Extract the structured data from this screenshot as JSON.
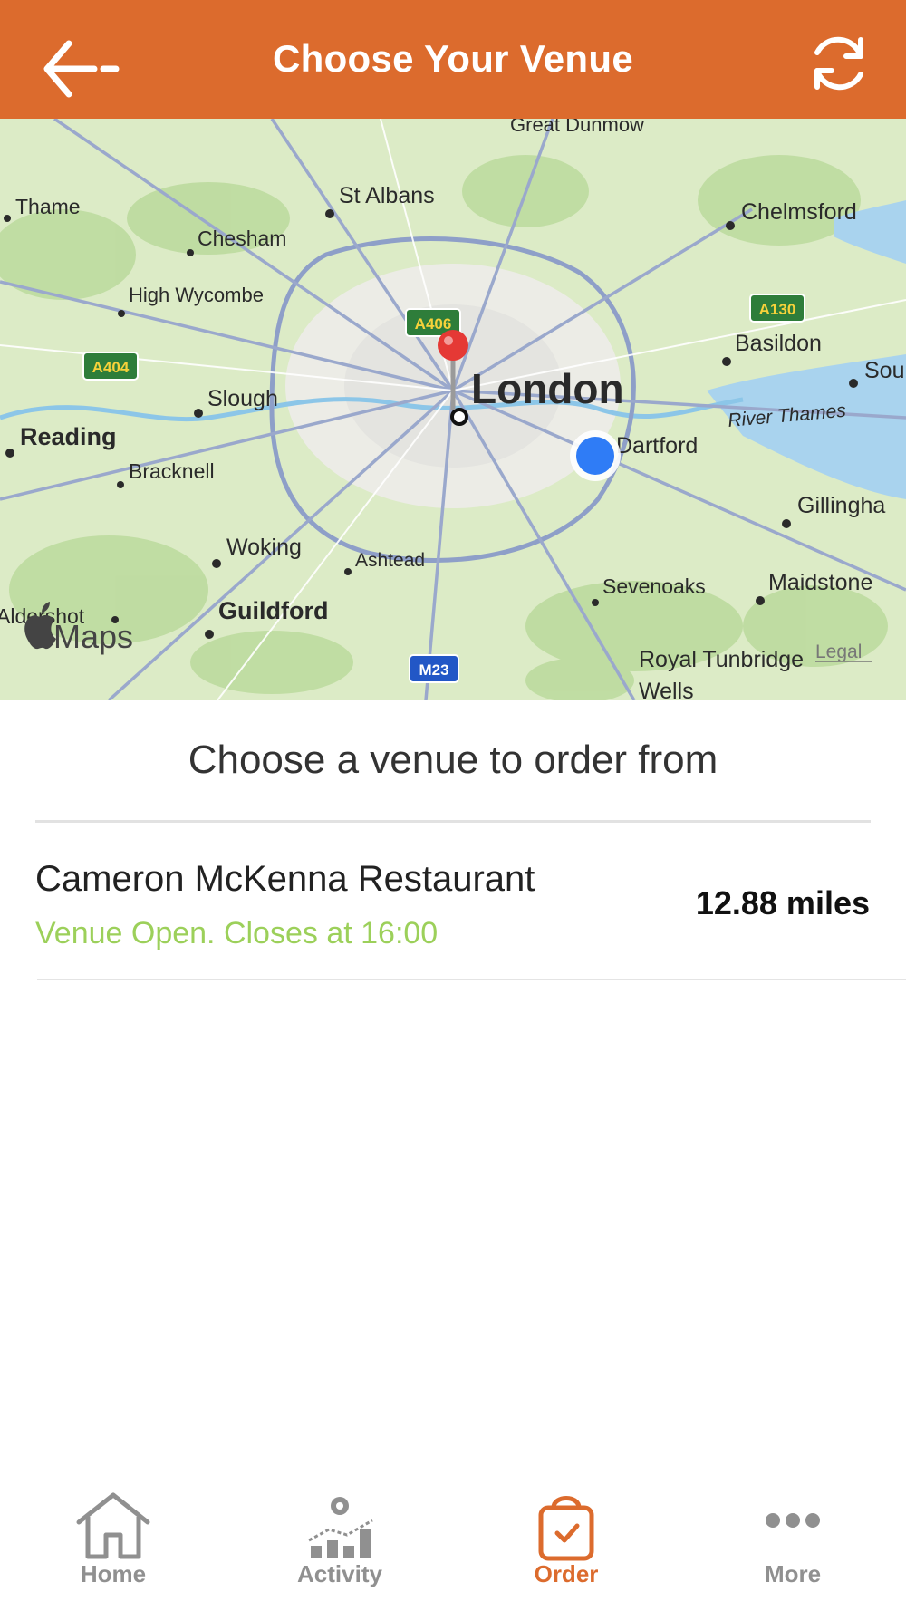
{
  "header": {
    "title": "Choose Your Venue",
    "back_icon": "arrow-left-icon",
    "refresh_icon": "refresh-icon"
  },
  "map": {
    "provider_label": "Maps",
    "legal_label": "Legal",
    "places": {
      "london": "London",
      "great_dunmow": "Great Dunmow",
      "thame": "Thame",
      "st_albans": "St Albans",
      "chesham": "Chesham",
      "chelmsford": "Chelmsford",
      "high_wycombe": "High Wycombe",
      "basildon": "Basildon",
      "southend": "Sou",
      "slough": "Slough",
      "reading": "Reading",
      "bracknell": "Bracknell",
      "dartford": "Dartford",
      "gillingham": "Gillingha",
      "woking": "Woking",
      "ashtead": "Ashtead",
      "sevenoaks": "Sevenoaks",
      "maidstone": "Maidstone",
      "aldershot": "Aldershot",
      "guildford": "Guildford",
      "royal_tunbridge": "Royal Tunbridge",
      "wells": "Wells",
      "river_thames": "River Thames"
    },
    "roads": {
      "a406": "A406",
      "a404": "A404",
      "a130": "A130",
      "m23": "M23"
    },
    "colors": {
      "venue_pin": "#e53935",
      "user_location": "#2f7cf6"
    }
  },
  "prompt": "Choose a venue to order from",
  "venues": [
    {
      "name": "Cameron McKenna Restaurant",
      "status": "Venue Open. Closes at 16:00",
      "distance": "12.88 miles"
    }
  ],
  "tabs": [
    {
      "label": "Home",
      "icon": "home-icon",
      "active": false
    },
    {
      "label": "Activity",
      "icon": "activity-chart-icon",
      "active": false
    },
    {
      "label": "Order",
      "icon": "shopping-bag-icon",
      "active": true
    },
    {
      "label": "More",
      "icon": "more-dots-icon",
      "active": false
    }
  ],
  "colors": {
    "brand": "#dc6b2d",
    "status_open": "#9cd05a"
  }
}
